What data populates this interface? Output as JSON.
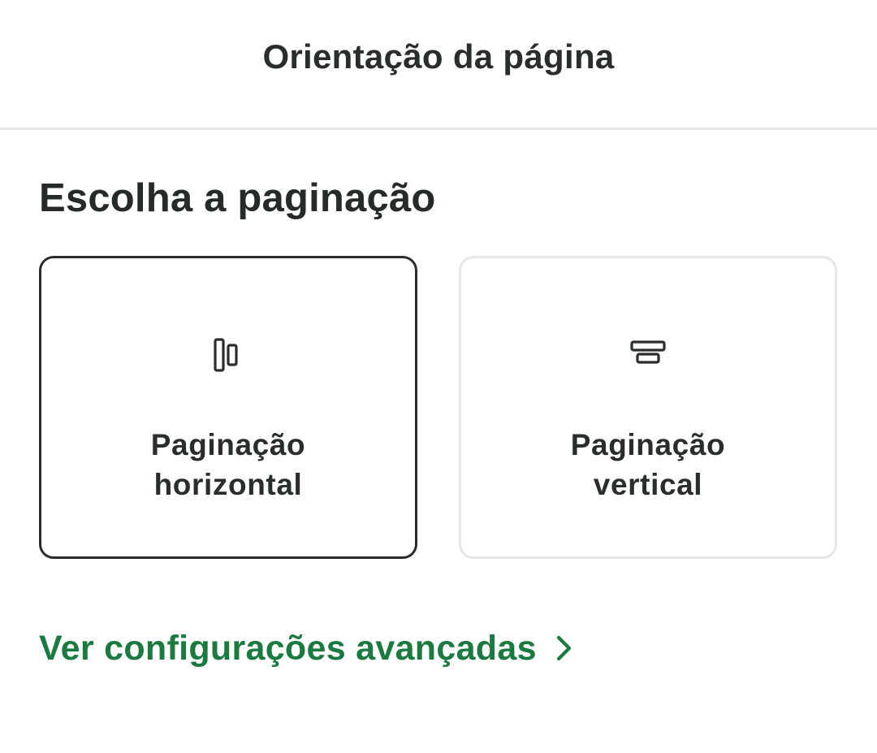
{
  "header": {
    "title": "Orientação da página"
  },
  "section": {
    "title": "Escolha a paginação"
  },
  "options": [
    {
      "line1": "Paginação",
      "line2": "horizontal",
      "icon": "horizontal-pagination-icon",
      "selected": true
    },
    {
      "line1": "Paginação",
      "line2": "vertical",
      "icon": "vertical-pagination-icon",
      "selected": false
    }
  ],
  "advanced": {
    "label": "Ver configurações avançadas",
    "icon": "chevron-right-icon"
  },
  "colors": {
    "text": "#2a2d2e",
    "accent": "#1a7a3f",
    "selected_border": "#2a2d2e",
    "unselected_border": "#e6e8e8",
    "divider": "#e4e6e6"
  }
}
